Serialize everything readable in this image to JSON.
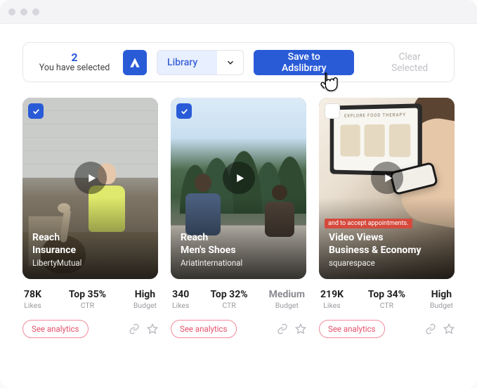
{
  "toolbar": {
    "selected_count": "2",
    "selected_label": "You have selected",
    "dropdown_value": "Library",
    "save_label": "Save to Adslibrary",
    "clear_label": "Clear Selected"
  },
  "cards": [
    {
      "checked": true,
      "goal": "Reach",
      "category": "Insurance",
      "brand": "LibertyMutual",
      "likes_value": "78K",
      "likes_label": "Likes",
      "ctr_value": "Top 35%",
      "ctr_label": "CTR",
      "budget_value": "High",
      "budget_label": "Budget",
      "budget_dim": false,
      "analytics_label": "See analytics"
    },
    {
      "checked": true,
      "goal": "Reach",
      "category": "Men's Shoes",
      "brand": "Ariatinternational",
      "likes_value": "340",
      "likes_label": "Likes",
      "ctr_value": "Top 32%",
      "ctr_label": "CTR",
      "budget_value": "Medium",
      "budget_label": "Budget",
      "budget_dim": true,
      "analytics_label": "See analytics"
    },
    {
      "checked": false,
      "goal": "Video Views",
      "category": "Business & Economy",
      "brand": "squarespace",
      "caption": "and to accept appointments.",
      "screen_title": "EXPLORE FOOD THERAPY",
      "likes_value": "219K",
      "likes_label": "Likes",
      "ctr_value": "Top 34%",
      "ctr_label": "CTR",
      "budget_value": "High",
      "budget_label": "Budget",
      "budget_dim": false,
      "analytics_label": "See analytics"
    }
  ]
}
